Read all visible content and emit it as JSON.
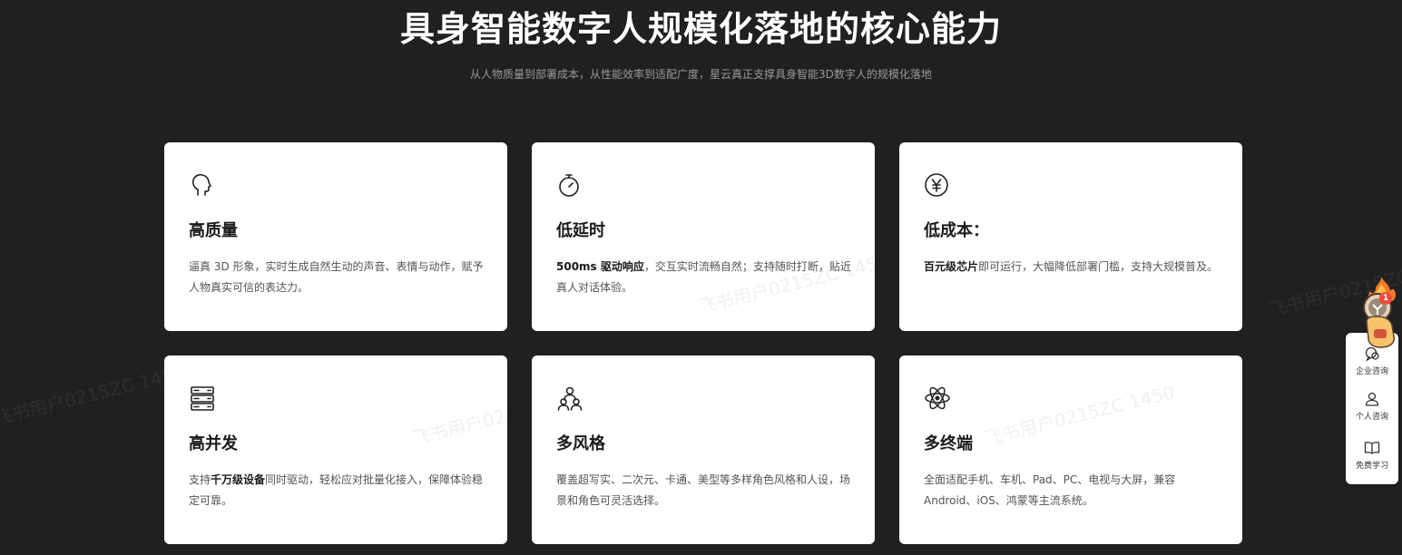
{
  "hero": {
    "title": "具身智能数字人规模化落地的核心能力",
    "subtitle": "从人物质量到部署成本，从性能效率到适配广度，星云真正支撑具身智能3D数字人的规模化落地"
  },
  "cards": [
    {
      "icon": "head-profile-icon",
      "title": "高质量",
      "desc_pre": "",
      "desc_bold": "",
      "desc_post": "逼真 3D 形象，实时生成自然生动的声音、表情与动作，赋予人物真实可信的表达力。"
    },
    {
      "icon": "stopwatch-icon",
      "title": "低延时",
      "desc_pre": "",
      "desc_bold": "500ms 驱动响应",
      "desc_post": "，交互实时流畅自然；支持随时打断，贴近真人对话体验。"
    },
    {
      "icon": "yen-coin-icon",
      "title": "低成本：",
      "desc_pre": "",
      "desc_bold": "百元级芯片",
      "desc_post": "即可运行，大幅降低部署门槛，支持大规模普及。"
    },
    {
      "icon": "server-stack-icon",
      "title": "高并发",
      "desc_pre": "支持",
      "desc_bold": "千万级设备",
      "desc_post": "同时驱动，轻松应对批量化接入，保障体验稳定可靠。"
    },
    {
      "icon": "users-group-icon",
      "title": "多风格",
      "desc_pre": "",
      "desc_bold": "",
      "desc_post": "覆盖超写实、二次元、卡通、美型等多样角色风格和人设，场景和角色可灵活选择。"
    },
    {
      "icon": "atom-icon",
      "title": "多终端",
      "desc_pre": "",
      "desc_bold": "",
      "desc_post": "全面适配手机、车机、Pad、PC、电视与大屏，兼容 Android、iOS、鸿蒙等主流系统。"
    }
  ],
  "sidebar": {
    "badge_count": "1",
    "items": [
      {
        "label": "企业咨询",
        "icon": "chat-bubbles-icon"
      },
      {
        "label": "个人咨询",
        "icon": "person-icon"
      },
      {
        "label": "免费学习",
        "icon": "open-book-icon"
      }
    ]
  },
  "watermark": "飞书用户0215ZC 1450"
}
